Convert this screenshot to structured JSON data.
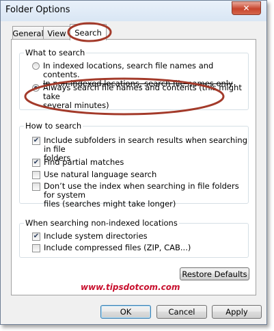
{
  "window": {
    "title": "Folder Options",
    "close_glyph": "✕"
  },
  "tabs": [
    {
      "label": "General"
    },
    {
      "label": "View"
    },
    {
      "label": "Search",
      "active": true
    }
  ],
  "what_to_search": {
    "heading": "What to search",
    "option1_line1": "In indexed locations, search file names and contents.",
    "option1_line2": "In non-indexed locations, search file names only",
    "option2_line1": "Always search file names and contents (this might take",
    "option2_line2": "several minutes)",
    "selected": 2
  },
  "how_to_search": {
    "heading": "How to search",
    "items": [
      {
        "line1": "Include subfolders in search results when searching in file",
        "line2": "folders",
        "checked": true
      },
      {
        "line1": "Find partial matches",
        "line2": "",
        "checked": true
      },
      {
        "line1": "Use natural language search",
        "line2": "",
        "checked": false
      },
      {
        "line1": "Don’t use the index when searching in file folders for system",
        "line2": "files (searches might take longer)",
        "checked": false
      }
    ]
  },
  "non_indexed": {
    "heading": "When searching non-indexed locations",
    "items": [
      {
        "label": "Include system directories",
        "checked": true
      },
      {
        "label": "Include compressed files (ZIP, CAB...)",
        "checked": false
      }
    ]
  },
  "restore_defaults_label": "Restore Defaults",
  "watermark": "www.tipsdotcom.com",
  "footer": {
    "ok": "OK",
    "cancel": "Cancel",
    "apply": "Apply"
  },
  "check_glyph": "✔",
  "colors": {
    "annotation": "#a33a2a",
    "watermark": "#c8102e",
    "close_button": "#c7452d"
  },
  "icons": [
    "close-icon",
    "radio-icon",
    "checkbox-icon"
  ]
}
